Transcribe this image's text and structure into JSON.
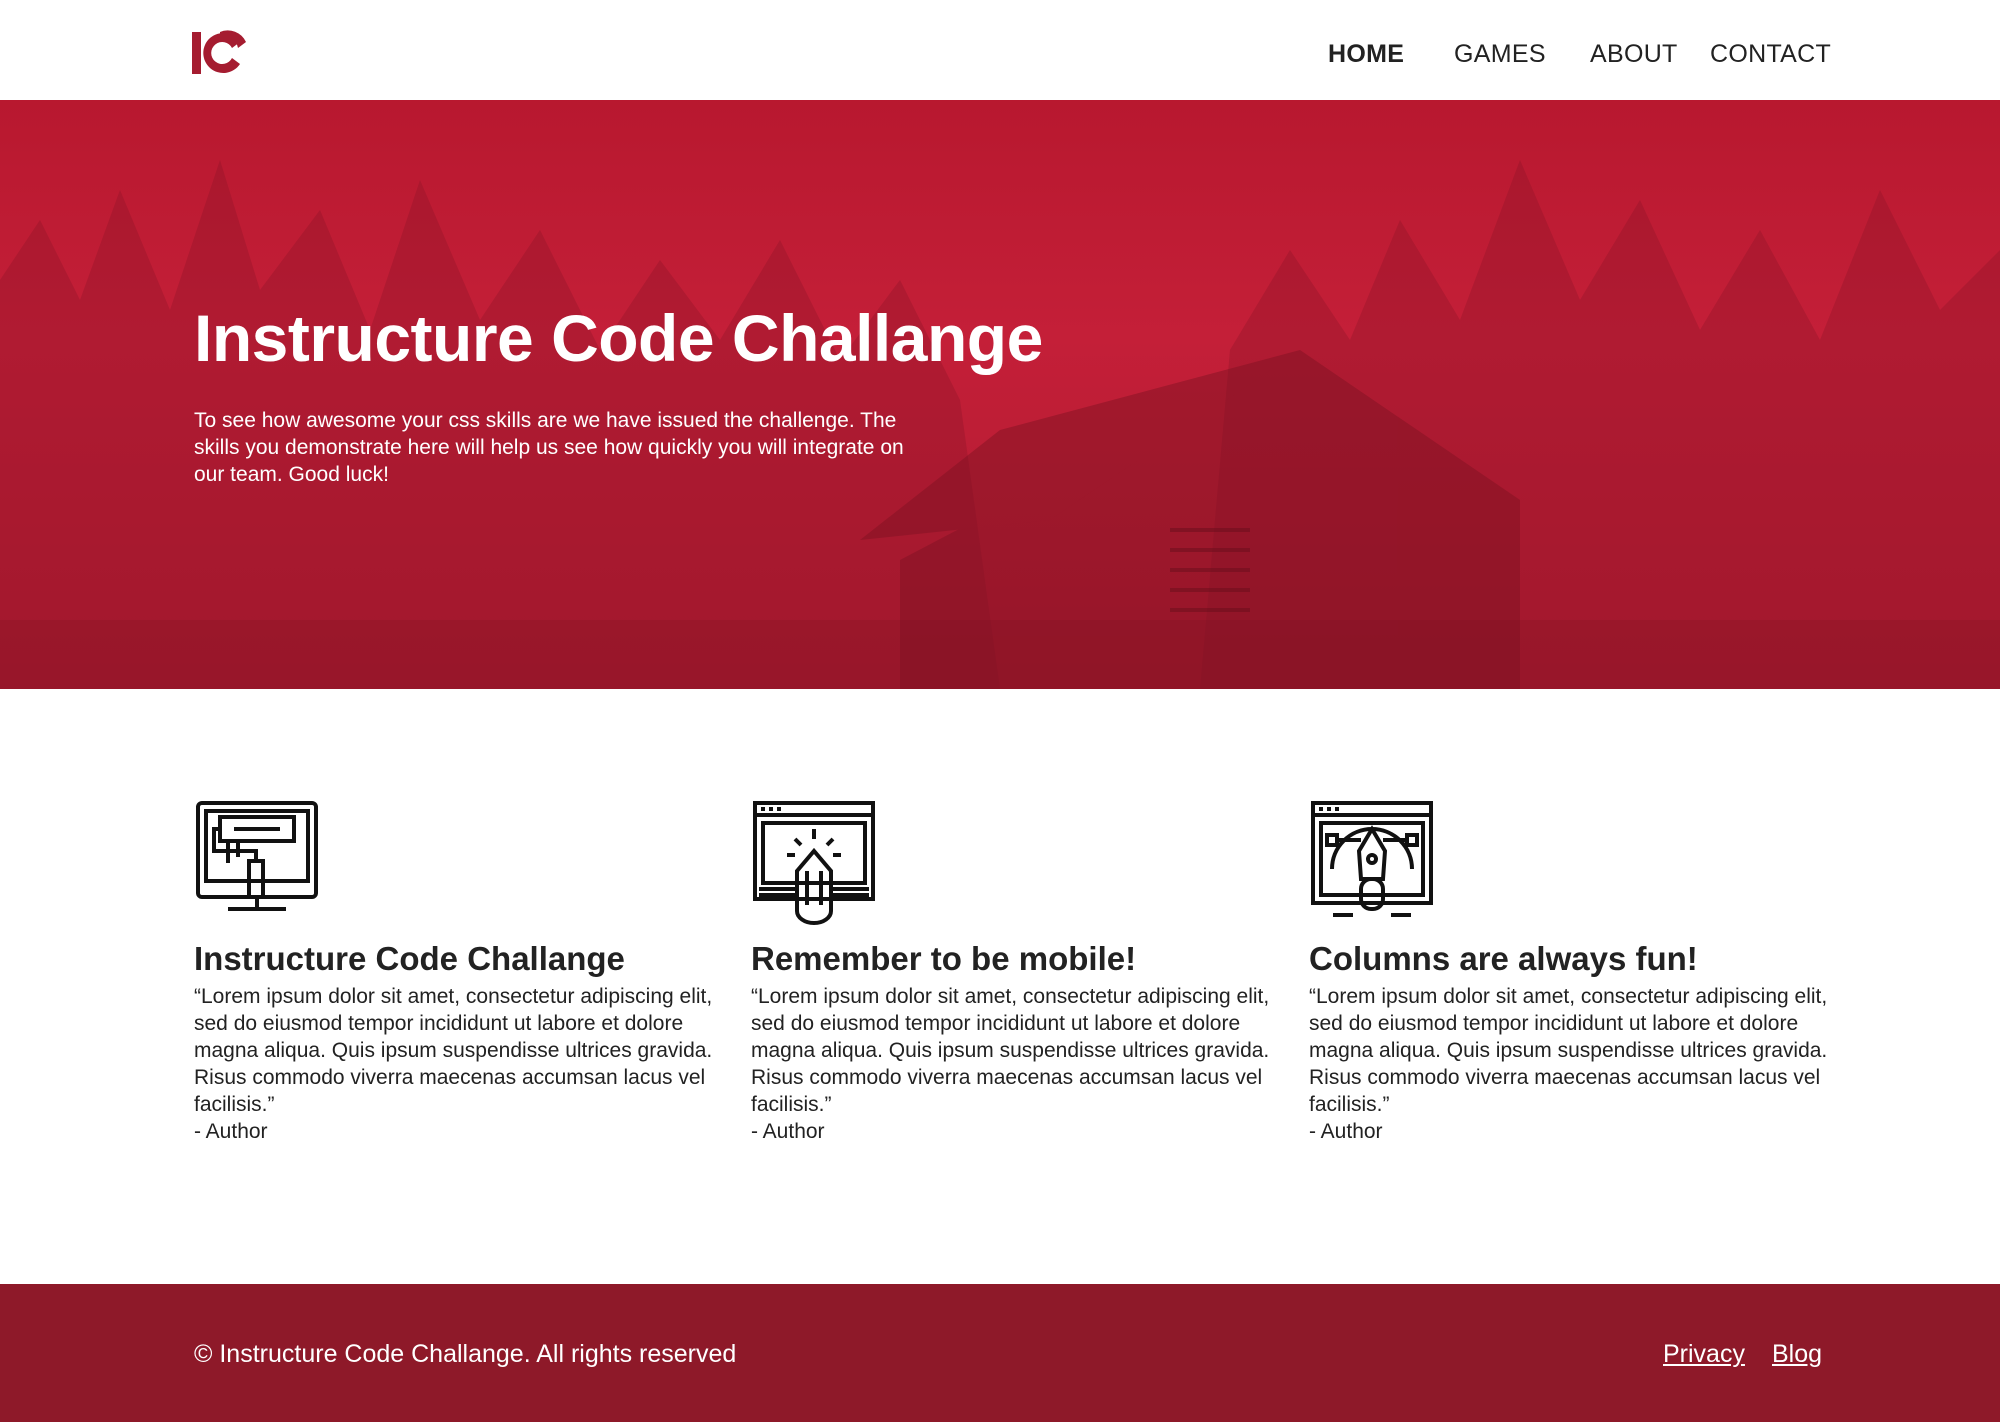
{
  "header": {
    "logo_text": "IC",
    "nav": [
      {
        "label": "HOME",
        "active": true
      },
      {
        "label": "GAMES",
        "active": false
      },
      {
        "label": "ABOUT",
        "active": false
      },
      {
        "label": "CONTACT",
        "active": false
      }
    ]
  },
  "hero": {
    "title": "Instructure Code Challange",
    "text": "To see how awesome your css skills are we have issued the challenge. The skills you demonstrate here will help us see how quickly you will integrate on our team. Good luck!"
  },
  "features": [
    {
      "icon": "monitor-paint-roller-icon",
      "title": "Instructure Code Challange",
      "quote": "“Lorem ipsum dolor sit amet, consectetur adipiscing elit, sed do eiusmod tempor incididunt ut labore et dolore magna aliqua. Quis ipsum suspendisse ultrices gravida. Risus commodo viverra maecenas accumsan lacus vel facilisis.”",
      "author": "- Author"
    },
    {
      "icon": "browser-pencil-icon",
      "title": "Remember to be mobile!",
      "quote": "“Lorem ipsum dolor sit amet, consectetur adipiscing elit, sed do eiusmod tempor incididunt ut labore et dolore magna aliqua. Quis ipsum suspendisse ultrices gravida. Risus commodo viverra maecenas accumsan lacus vel facilisis.”",
      "author": "- Author"
    },
    {
      "icon": "browser-pen-tool-icon",
      "title": "Columns are always fun!",
      "quote": "“Lorem ipsum dolor sit amet, consectetur adipiscing elit, sed do eiusmod tempor incididunt ut labore et dolore magna aliqua. Quis ipsum suspendisse ultrices gravida. Risus commodo viverra maecenas accumsan lacus vel facilisis.”",
      "author": "- Author"
    }
  ],
  "footer": {
    "copyright": "© Instructure Code Challange. All rights reserved",
    "links": [
      "Privacy",
      "Blog"
    ]
  },
  "colors": {
    "brand_red": "#c41f38",
    "footer_red": "#8e1929",
    "logo_red": "#a51c30"
  }
}
